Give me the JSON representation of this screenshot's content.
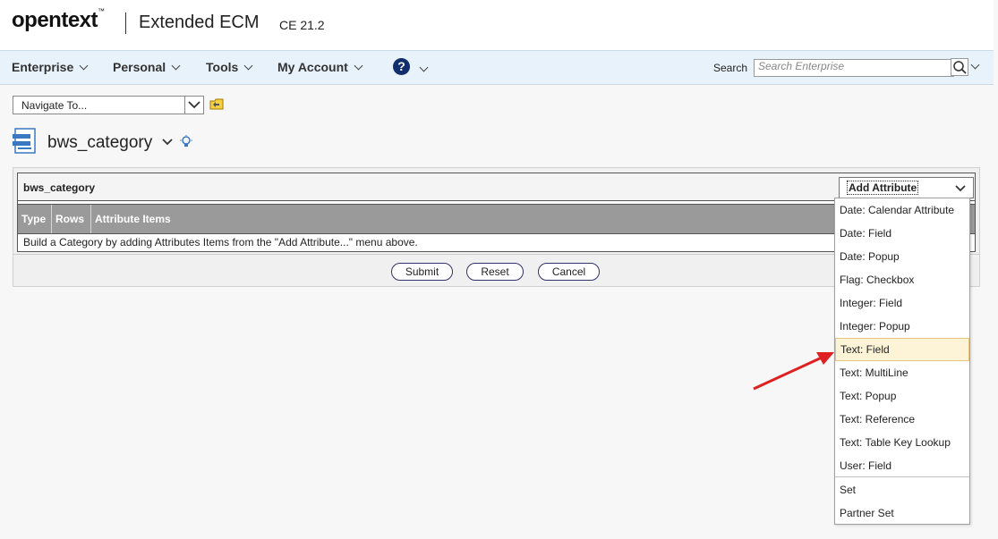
{
  "header": {
    "brand": "opentext",
    "brand_tm": "™",
    "product": "Extended ECM",
    "version": "CE 21.2"
  },
  "nav": {
    "items": [
      {
        "label": "Enterprise"
      },
      {
        "label": "Personal"
      },
      {
        "label": "Tools"
      },
      {
        "label": "My Account"
      }
    ],
    "help_icon": "?",
    "search_label": "Search",
    "search_placeholder": "Search Enterprise"
  },
  "navigate": {
    "value": "Navigate To..."
  },
  "category": {
    "title": "bws_category",
    "name_field": "bws_category"
  },
  "table": {
    "headers": [
      "Type",
      "Rows",
      "Attribute Items"
    ],
    "empty_message": "Build a Category by adding Attributes Items from the \"Add Attribute...\" menu above."
  },
  "buttons": {
    "submit": "Submit",
    "reset": "Reset",
    "cancel": "Cancel"
  },
  "add_attribute": {
    "label": "Add Attribute",
    "options": [
      "Date: Calendar Attribute",
      "Date: Field",
      "Date: Popup",
      "Flag: Checkbox",
      "Integer: Field",
      "Integer: Popup",
      "Text: Field",
      "Text: MultiLine",
      "Text: Popup",
      "Text: Reference",
      "Text: Table Key Lookup",
      "User: Field",
      "Set",
      "Partner Set"
    ],
    "highlighted": "Text: Field"
  },
  "colors": {
    "nav_bg": "#e8f2fa",
    "highlight_bg": "#fdf3d6",
    "arrow": "#e02020",
    "header_bg": "#9a9a9a"
  }
}
